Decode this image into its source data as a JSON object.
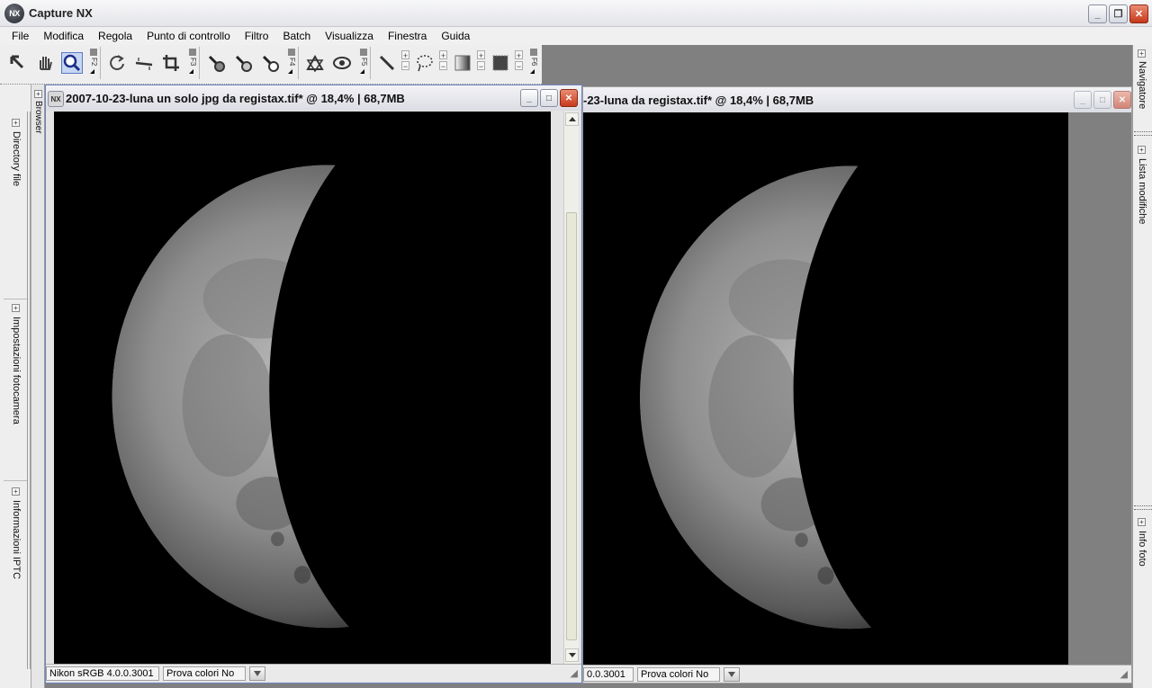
{
  "app": {
    "title": "Capture NX",
    "logo_text": "NX"
  },
  "menu": [
    "File",
    "Modifica",
    "Regola",
    "Punto di controllo",
    "Filtro",
    "Batch",
    "Visualizza",
    "Finestra",
    "Guida"
  ],
  "toolbar": {
    "group_keys": [
      "F2",
      "F3",
      "F4",
      "F5",
      "F6"
    ],
    "tools": [
      "arrow-icon",
      "hand-icon",
      "zoom-icon",
      "rotate-icon",
      "straighten-icon",
      "crop-icon",
      "black-point-dropper-icon",
      "neutral-point-dropper-icon",
      "white-point-dropper-icon",
      "red-eye-icon",
      "eye-icon",
      "brush-icon",
      "lasso-icon",
      "gradient-icon",
      "marquee-icon"
    ],
    "active_tool": "zoom-icon"
  },
  "left_dock": {
    "top_tab": "Browser",
    "panels": [
      "Directory file",
      "Impostazioni fotocamera",
      "Informazioni IPTC"
    ]
  },
  "right_dock": {
    "panels": [
      "Navigatore",
      "Lista modifiche",
      "Info foto"
    ]
  },
  "window_left": {
    "title": "2007-10-23-luna un solo jpg da registax.tif* @ 18,4% | 68,7MB",
    "profile": "Nikon sRGB 4.0.0.3001",
    "softproof": "Prova colori No"
  },
  "window_right": {
    "title": "-23-luna da registax.tif* @ 18,4% | 68,7MB",
    "profile": "0.0.3001",
    "softproof": "Prova colori No"
  },
  "colors": {
    "active_close": "#c73a1c",
    "workspace": "#808080",
    "canvas": "#000000"
  }
}
